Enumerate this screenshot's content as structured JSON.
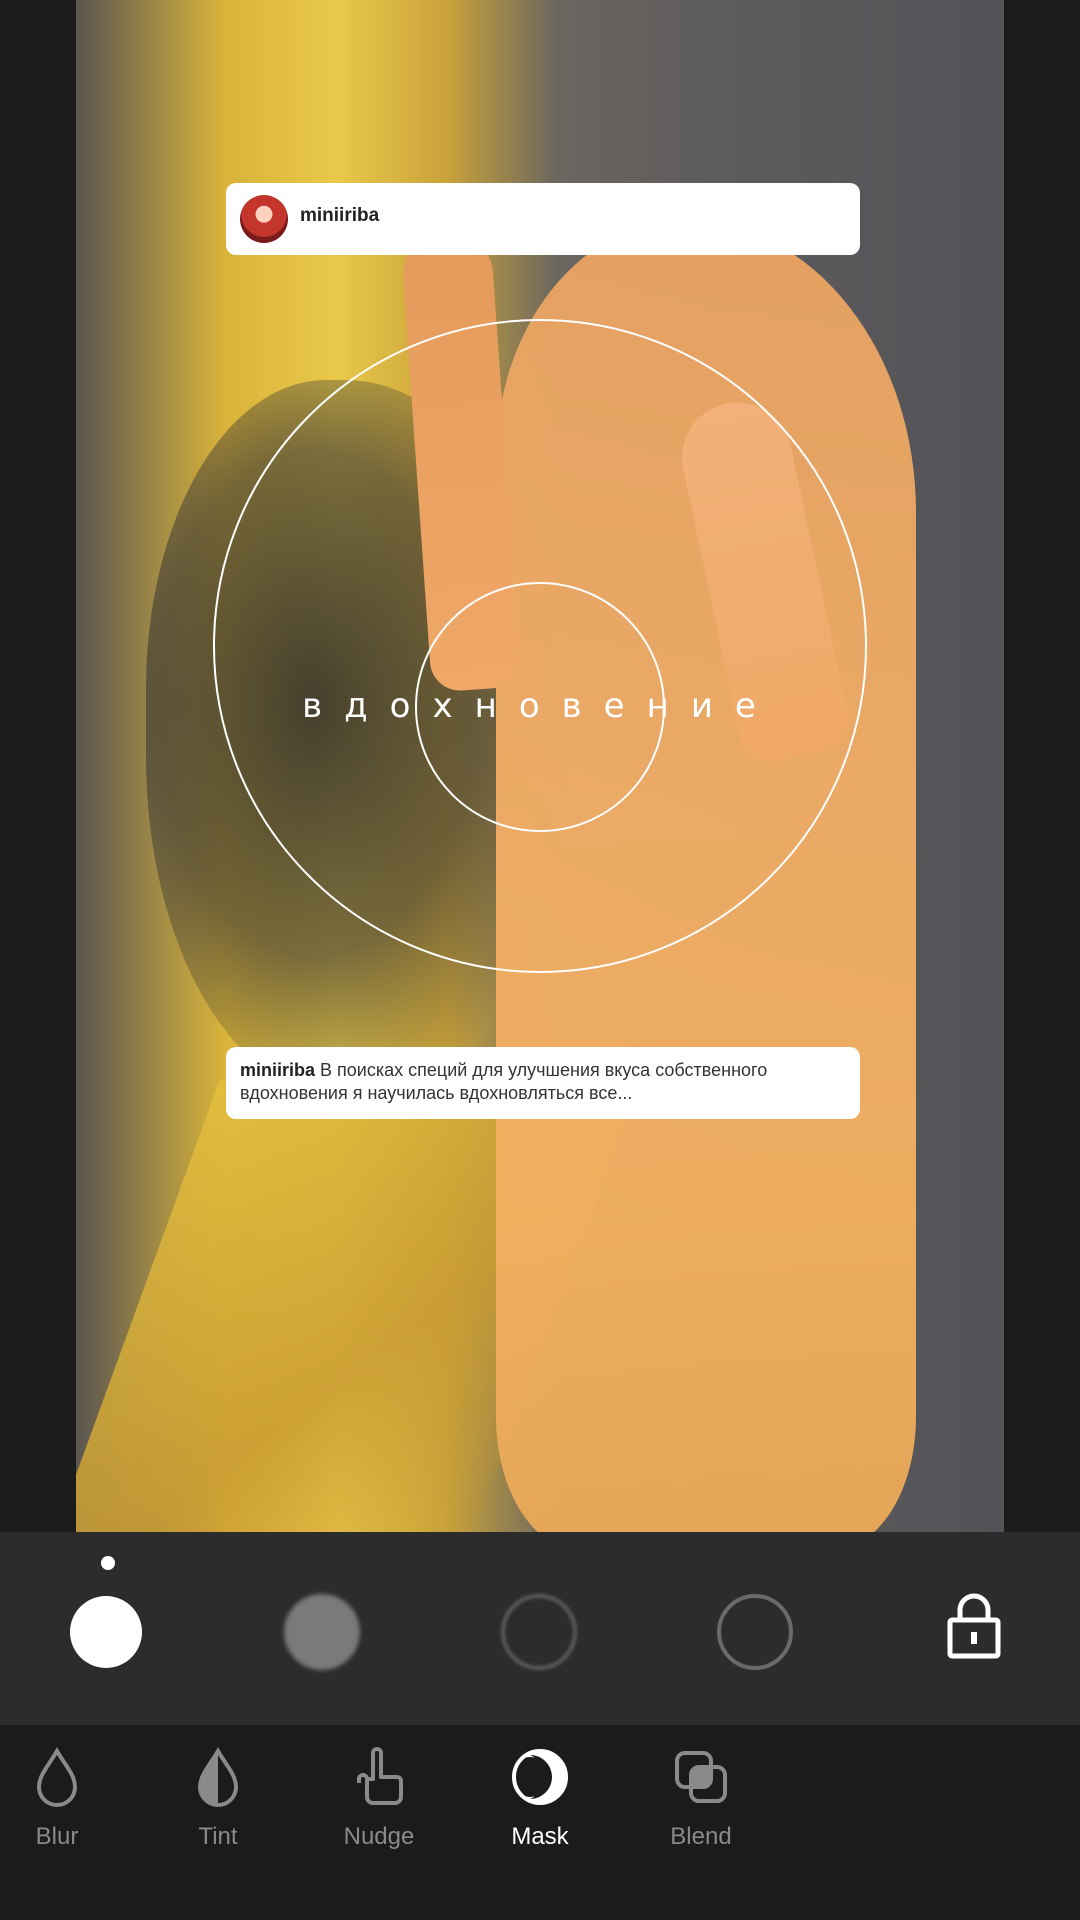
{
  "card_top": {
    "username": "miniiriba"
  },
  "overlay": {
    "word": "вдохновение"
  },
  "card_bottom": {
    "username": "miniiriba",
    "caption": "В поисках специй для улучшения вкуса собственного вдохновения я научилась вдохновляться все..."
  },
  "shapes": [
    {
      "name": "solid-white-circle",
      "selected": true
    },
    {
      "name": "soft-gray-circle",
      "selected": false
    },
    {
      "name": "soft-outline-circle",
      "selected": false
    },
    {
      "name": "outline-circle",
      "selected": false
    }
  ],
  "tabs": [
    {
      "label": "Blur",
      "icon": "droplet-outline-icon",
      "active": false
    },
    {
      "label": "Tint",
      "icon": "droplet-half-icon",
      "active": false
    },
    {
      "label": "Nudge",
      "icon": "hand-pointer-icon",
      "active": false
    },
    {
      "label": "Mask",
      "icon": "crescent-mask-icon",
      "active": true
    },
    {
      "label": "Blend",
      "icon": "overlapping-squares-icon",
      "active": false
    }
  ],
  "colors": {
    "selector_bg": "#2c2c2c",
    "tabbar_bg": "#1b1b1b",
    "active_label": "#ffffff",
    "inactive_label": "#8a8a8a"
  }
}
